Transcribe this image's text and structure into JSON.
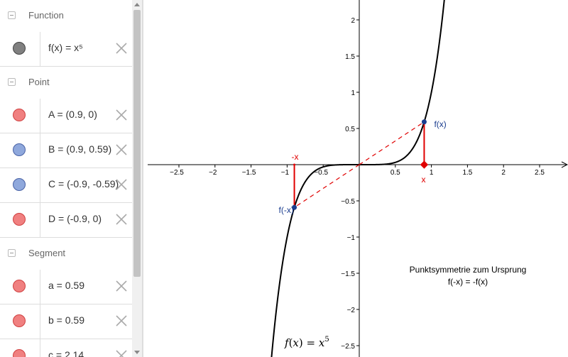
{
  "algebra": {
    "groups": [
      {
        "label": "Function",
        "items": [
          {
            "expr": "f(x) = x⁵",
            "color": "#808080",
            "border": "#444444"
          }
        ]
      },
      {
        "label": "Point",
        "items": [
          {
            "expr": "A = (0.9, 0)",
            "color": "#f08080",
            "border": "#d04040"
          },
          {
            "expr": "B = (0.9, 0.59)",
            "color": "#8fa8dc",
            "border": "#4a63a6"
          },
          {
            "expr": "C = (-0.9, -0.59)",
            "color": "#8fa8dc",
            "border": "#4a63a6"
          },
          {
            "expr": "D = (-0.9, 0)",
            "color": "#f08080",
            "border": "#d04040"
          }
        ]
      },
      {
        "label": "Segment",
        "items": [
          {
            "expr": "a = 0.59",
            "color": "#f08080",
            "border": "#d04040"
          },
          {
            "expr": "b = 0.59",
            "color": "#f08080",
            "border": "#d04040"
          },
          {
            "expr": "c = 2.14",
            "color": "#f08080",
            "border": "#d04040"
          }
        ]
      }
    ]
  },
  "graph": {
    "x_ticks": [
      "−2.5",
      "−2",
      "−1.5",
      "−1",
      "−0.5",
      "0.5",
      "1",
      "1.5",
      "2",
      "2.5"
    ],
    "y_ticks": [
      "2",
      "1.5",
      "1",
      "0.5",
      "−0.5",
      "−1",
      "−1.5",
      "−2",
      "−2.5"
    ],
    "labels": {
      "fx": "f(x)",
      "fmx": "f(-x)",
      "x": "x",
      "mx": "-x"
    },
    "note_line1": "Punktsymmetrie zum Ursprung",
    "note_line2": "f(-x) = -f(x)",
    "formula_f": "f",
    "formula_x": "x",
    "formula_exp": "5",
    "colors": {
      "curve": "#000000",
      "red": "#e00000",
      "point": "#1a3d8f",
      "label_blue": "#1a3d8f"
    }
  }
}
